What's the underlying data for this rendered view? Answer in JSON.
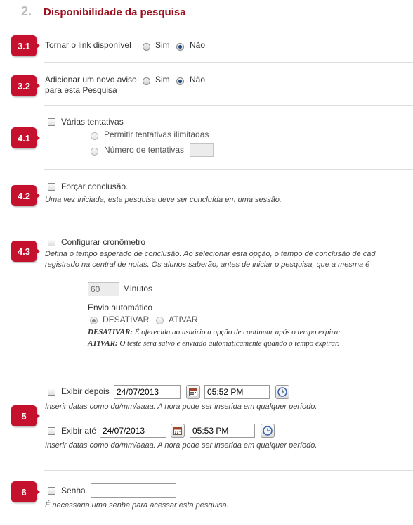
{
  "header": {
    "number": "2.",
    "title": "Disponibilidade da pesquisa"
  },
  "s31": {
    "badge": "3.1",
    "label": "Tornar o link disponível",
    "yes": "Sim",
    "no": "Não"
  },
  "s32": {
    "badge": "3.2",
    "label_line1": "Adicionar um novo aviso",
    "label_line2": "para esta Pesquisa",
    "yes": "Sim",
    "no": "Não"
  },
  "s41": {
    "badge": "4.1",
    "label": "Várias tentativas",
    "opt_unlimited": "Permitir tentativas ilimitadas",
    "opt_number": "Número de tentativas",
    "attempts_value": ""
  },
  "s42": {
    "badge": "4.2",
    "label": "Forçar conclusão.",
    "hint": "Uma vez iniciada, esta pesquisa deve ser concluída em uma sessão."
  },
  "s43": {
    "badge": "4.3",
    "label": "Configurar cronômetro",
    "hint_line1": "Defina o tempo esperado de conclusão. Ao selecionar esta opção, o tempo de conclusão de cad",
    "hint_line2": "registrado na central de notas. Os alunos saberão, antes de iniciar o pesquisa, que a mesma é",
    "minutes_value": "60",
    "minutes_label": "Minutos",
    "auto_submit_label": "Envio automático",
    "off_label": "DESATIVAR",
    "on_label": "ATIVAR",
    "off_desc_key": "DESATIVAR:",
    "off_desc": " É oferecida ao usuário a opção de continuar após o tempo expirar.",
    "on_desc_key": "ATIVAR:",
    "on_desc": " O teste será salvo e enviado automaticamente quando o tempo expirar."
  },
  "s5": {
    "badge": "5",
    "after_label": "Exibir depois",
    "after_date": "24/07/2013",
    "after_time": "05:52 PM",
    "until_label": "Exibir até",
    "until_date": "24/07/2013",
    "until_time": "05:53 PM",
    "hint": "Inserir datas como dd/mm/aaaa. A hora pode ser inserida em qualquer período."
  },
  "s6": {
    "badge": "6",
    "label": "Senha",
    "password_value": "",
    "hint": "É necessária uma senha para acessar esta pesquisa."
  },
  "colors": {
    "accent": "#c5102e",
    "title": "#9b1120",
    "radio_selected": "#1f4a80"
  },
  "icons": {
    "calendar": "calendar-icon",
    "clock": "clock-icon"
  }
}
